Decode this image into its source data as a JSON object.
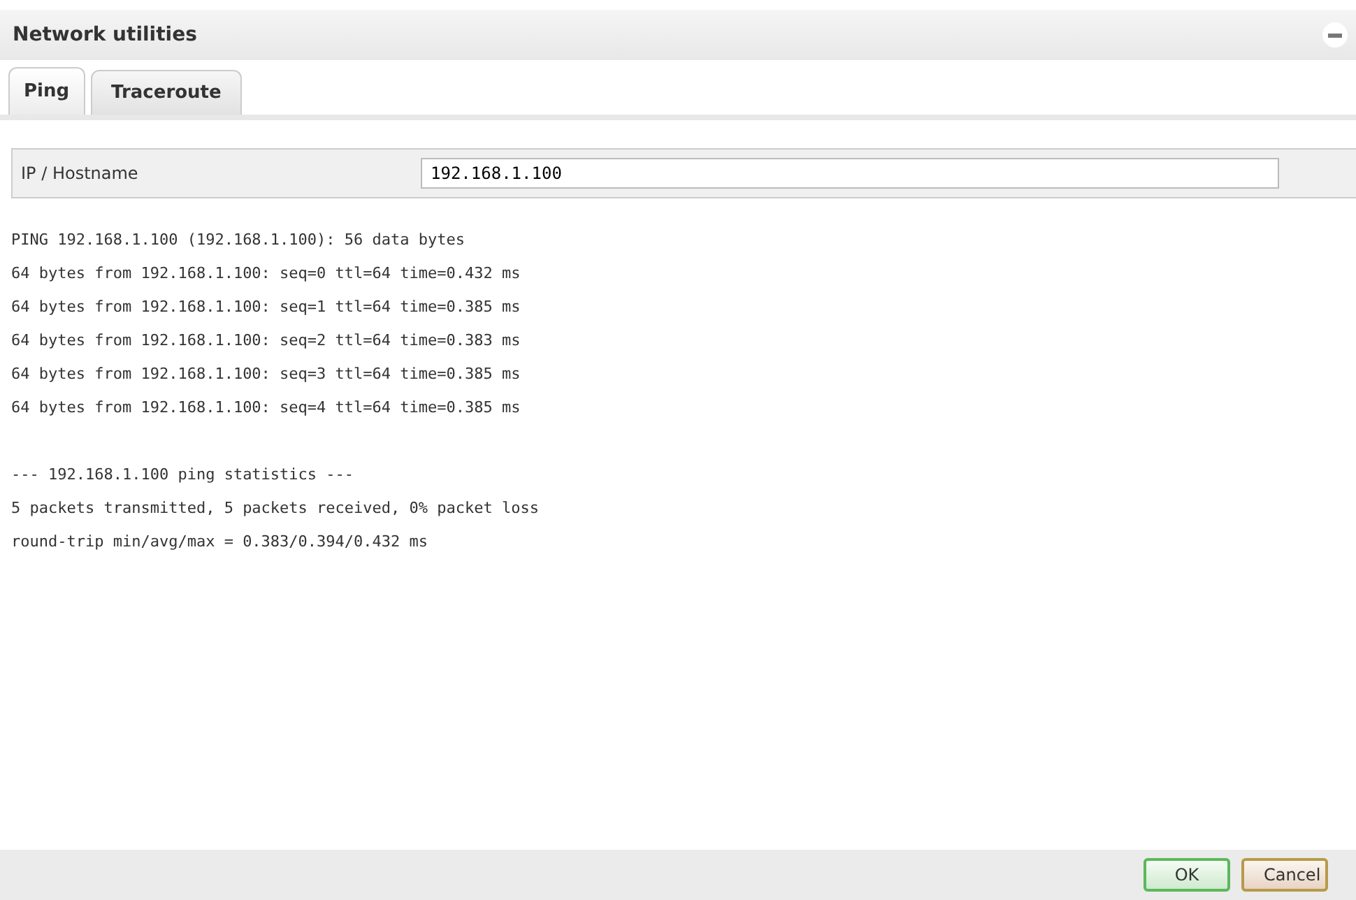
{
  "window": {
    "title": "Network utilities"
  },
  "tabs": [
    {
      "label": "Ping",
      "selected": true
    },
    {
      "label": "Traceroute",
      "selected": false
    }
  ],
  "host_field": {
    "label": "IP / Hostname",
    "value": "192.168.1.100"
  },
  "output_blocks": [
    {
      "lines": [
        "PING 192.168.1.100 (192.168.1.100): 56 data bytes",
        "64 bytes from 192.168.1.100: seq=0 ttl=64 time=0.432 ms",
        "64 bytes from 192.168.1.100: seq=1 ttl=64 time=0.385 ms",
        "64 bytes from 192.168.1.100: seq=2 ttl=64 time=0.383 ms",
        "64 bytes from 192.168.1.100: seq=3 ttl=64 time=0.385 ms",
        "64 bytes from 192.168.1.100: seq=4 ttl=64 time=0.385 ms"
      ]
    },
    {
      "lines": [
        "--- 192.168.1.100 ping statistics ---",
        "5 packets transmitted, 5 packets received, 0% packet loss",
        "round-trip min/avg/max = 0.383/0.394/0.432 ms"
      ]
    }
  ],
  "buttons": [
    {
      "label": "OK",
      "kind": "ok"
    },
    {
      "label": "Cancel",
      "kind": "cancel"
    }
  ]
}
